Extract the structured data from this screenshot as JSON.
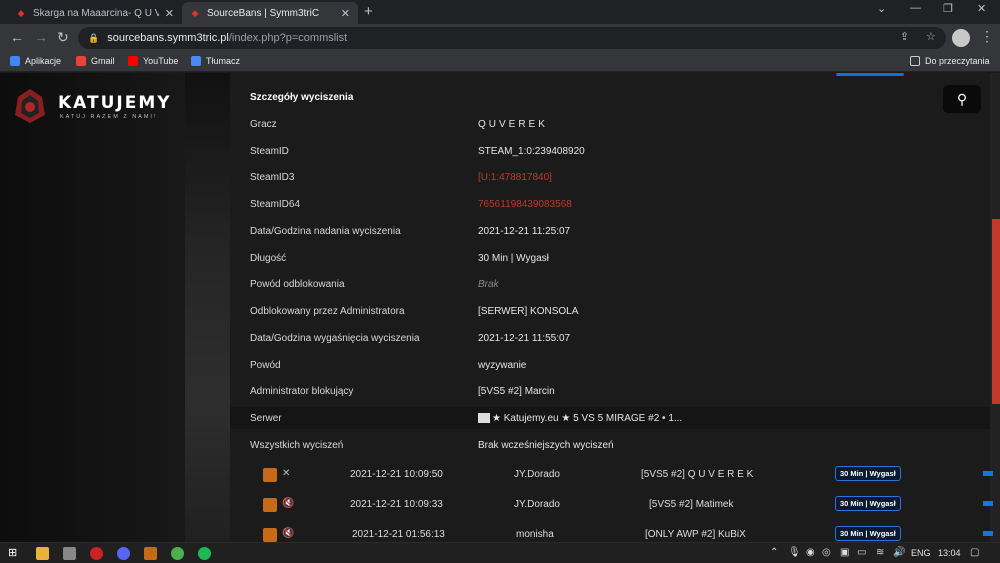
{
  "browser": {
    "tabs": [
      {
        "title": "Skarga na Maaarcina- Q U V E R E K",
        "close": "✕"
      },
      {
        "title": "SourceBans | Symm3triC",
        "close": "✕"
      }
    ],
    "new_tab": "+",
    "url_host": "sourcebans.symm3tric.pl",
    "url_path": "/index.php?p=commslist",
    "bookmarks": [
      "Aplikacje",
      "Gmail",
      "YouTube",
      "Tłumacz"
    ],
    "reading_list": "Do przeczytania"
  },
  "site": {
    "logo_title": "KATUJEMY",
    "logo_subtitle": "KATUJ RAZEM Z NAMI!"
  },
  "details": {
    "title": "Szczegóły wyciszenia",
    "rows": [
      {
        "key": "Gracz",
        "value": "QUVEREK"
      },
      {
        "key": "SteamID",
        "value": "STEAM_1:0:239408920"
      },
      {
        "key": "SteamID3",
        "value": "[U:1:478817840]"
      },
      {
        "key": "SteamID64",
        "value": "76561198439083568"
      },
      {
        "key": "Data/Godzina nadania wyciszenia",
        "value": "2021-12-21 11:25:07"
      },
      {
        "key": "Długość",
        "value": "30 Min | Wygasł"
      },
      {
        "key": "Powód odblokowania",
        "value": "Brak"
      },
      {
        "key": "Odblokowany przez Administratora",
        "value": "[SERWER] KONSOLA"
      },
      {
        "key": "Data/Godzina wygaśnięcia wyciszenia",
        "value": "2021-12-21 11:55:07"
      },
      {
        "key": "Powód",
        "value": "wyzywanie"
      },
      {
        "key": "Administrator blokujący",
        "value": "[5VS5 #2] Marcin"
      },
      {
        "key": "Serwer",
        "value": "★ Katujemy.eu ★ 5 VS 5 MIRAGE #2 • 1..."
      },
      {
        "key": "Wszystkich wyciszeń",
        "value": "Brak wcześniejszych wyciszeń"
      }
    ]
  },
  "history": [
    {
      "date": "2021-12-21 10:09:50",
      "admin": "JY.Dorado",
      "player": "[5VS5 #2] Q U V E R E K",
      "badge": "30 Min | Wygasł"
    },
    {
      "date": "2021-12-21 10:09:33",
      "admin": "JY.Dorado",
      "player": "[5VS5 #2] Matimek",
      "badge": "30 Min | Wygasł"
    },
    {
      "date": "2021-12-21 01:56:13",
      "admin": "monisha",
      "player": "[ONLY AWP #2] KuBiX",
      "badge": "30 Min | Wygasł"
    }
  ],
  "taskbar": {
    "lang": "ENG",
    "time": "13:04"
  },
  "colors": {
    "accent_red": "#c0392b",
    "badge_blue": "#2f72d8"
  }
}
